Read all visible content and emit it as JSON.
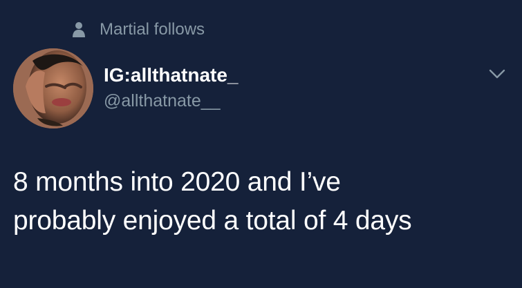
{
  "social_context": {
    "icon": "person-icon",
    "text": "Martial follows"
  },
  "author": {
    "display_name": "IG:allthatnate_",
    "handle": "@allthatnate__",
    "avatar": "avatar"
  },
  "tweet": {
    "line1": "8 months into 2020 and I’ve",
    "line2": "probably enjoyed a total of 4 days"
  },
  "menu": {
    "icon": "chevron-down-icon"
  },
  "colors": {
    "background": "#15213a",
    "primary_text": "#ffffff",
    "secondary_text": "#8899a6"
  }
}
